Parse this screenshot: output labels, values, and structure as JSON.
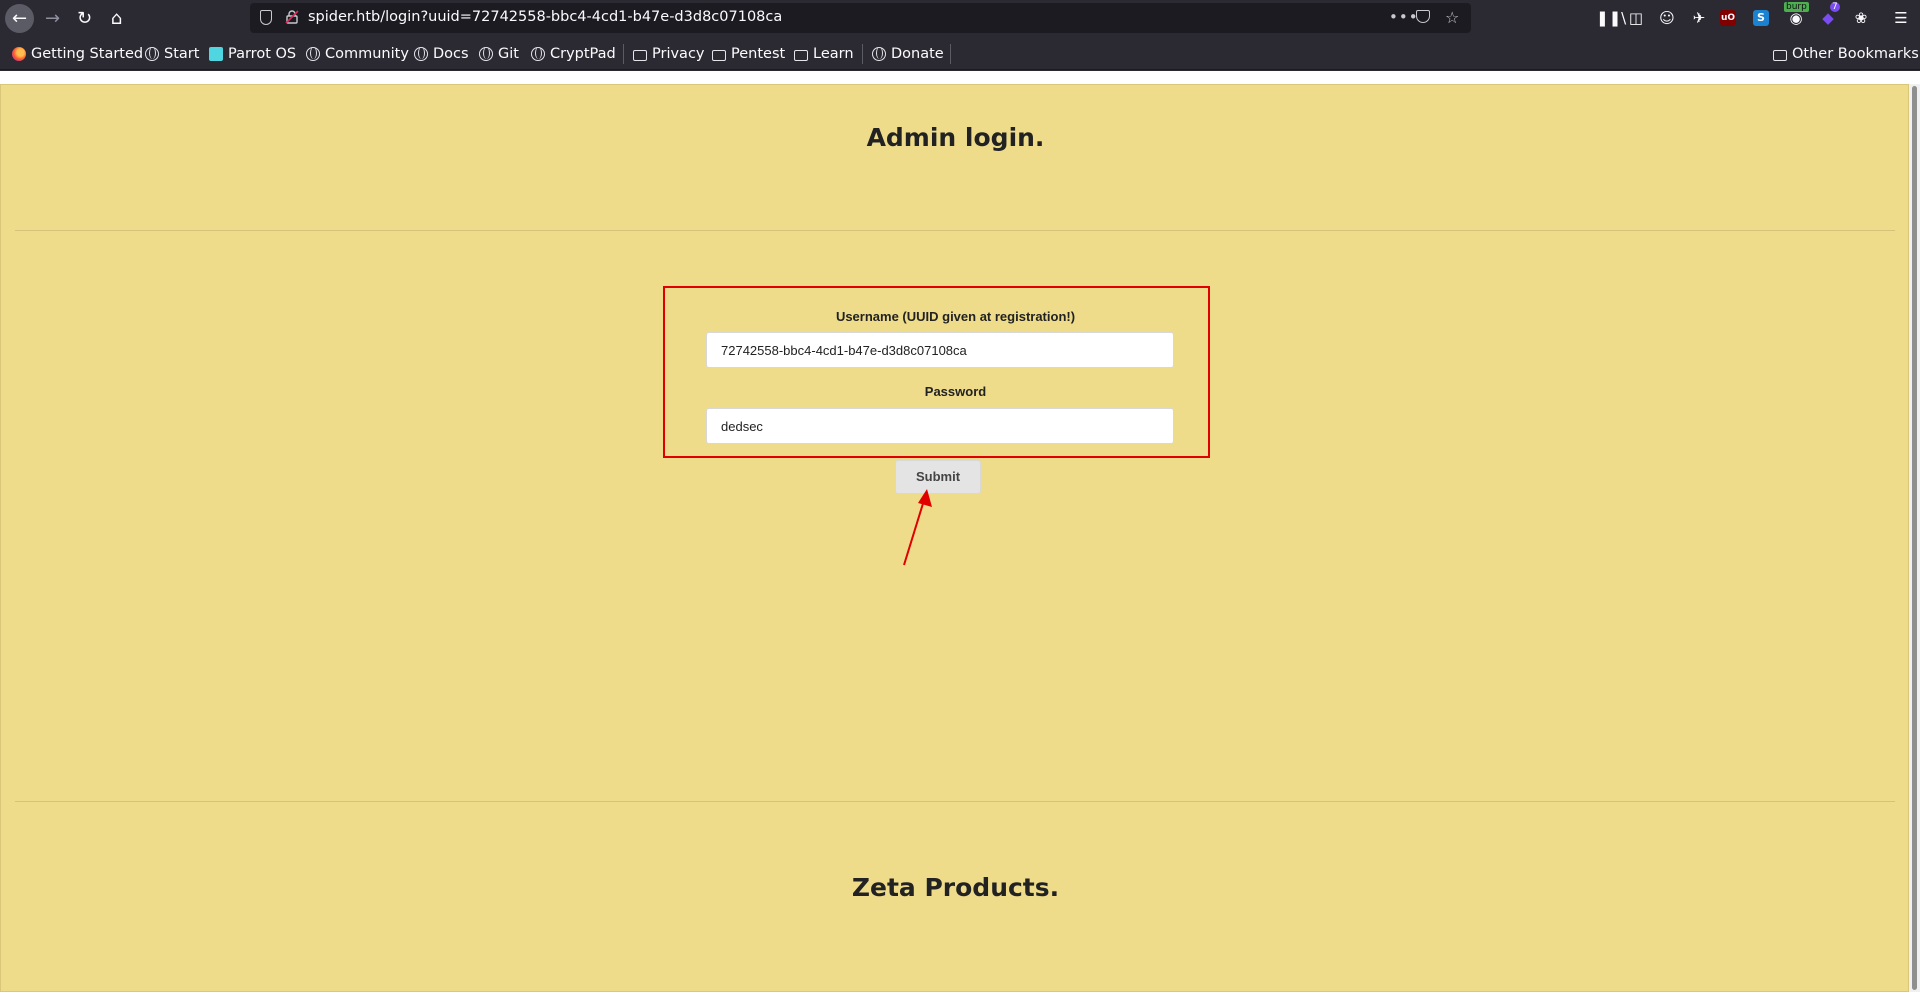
{
  "browser": {
    "url": "spider.htb/login?uuid=72742558-bbc4-4cd1-b47e-d3d8c07108ca",
    "toolbar_icons": [
      "library-icon",
      "sidebar-icon",
      "account-icon",
      "extension-icon",
      "ublock-icon",
      "s-extension-icon",
      "burp-extension-icon",
      "extension-badge-icon",
      "cookie-icon",
      "menu-icon"
    ],
    "burp_badge": "burp",
    "ext_badge": "7"
  },
  "bookmarks": {
    "items": [
      {
        "label": "Getting Started",
        "icon": "firefox-icon"
      },
      {
        "label": "Start",
        "icon": "globe-icon"
      },
      {
        "label": "Parrot OS",
        "icon": "parrot-icon"
      },
      {
        "label": "Community",
        "icon": "globe-icon"
      },
      {
        "label": "Docs",
        "icon": "globe-icon"
      },
      {
        "label": "Git",
        "icon": "globe-icon"
      },
      {
        "label": "CryptPad",
        "icon": "globe-icon"
      },
      {
        "label": "Privacy",
        "icon": "folder-icon"
      },
      {
        "label": "Pentest",
        "icon": "folder-icon"
      },
      {
        "label": "Learn",
        "icon": "folder-icon"
      },
      {
        "label": "Donate",
        "icon": "globe-icon"
      }
    ],
    "other": "Other Bookmarks"
  },
  "page": {
    "title": "Admin login.",
    "username_label": "Username (UUID given at registration!)",
    "username_value": "72742558-bbc4-4cd1-b47e-d3d8c07108ca",
    "password_label": "Password",
    "password_value": "dedsec",
    "submit_label": "Submit",
    "footer_title": "Zeta Products."
  },
  "colors": {
    "page_bg": "#eedc8a",
    "annotation": "#e00000",
    "chrome_bg": "#2b2a33"
  }
}
